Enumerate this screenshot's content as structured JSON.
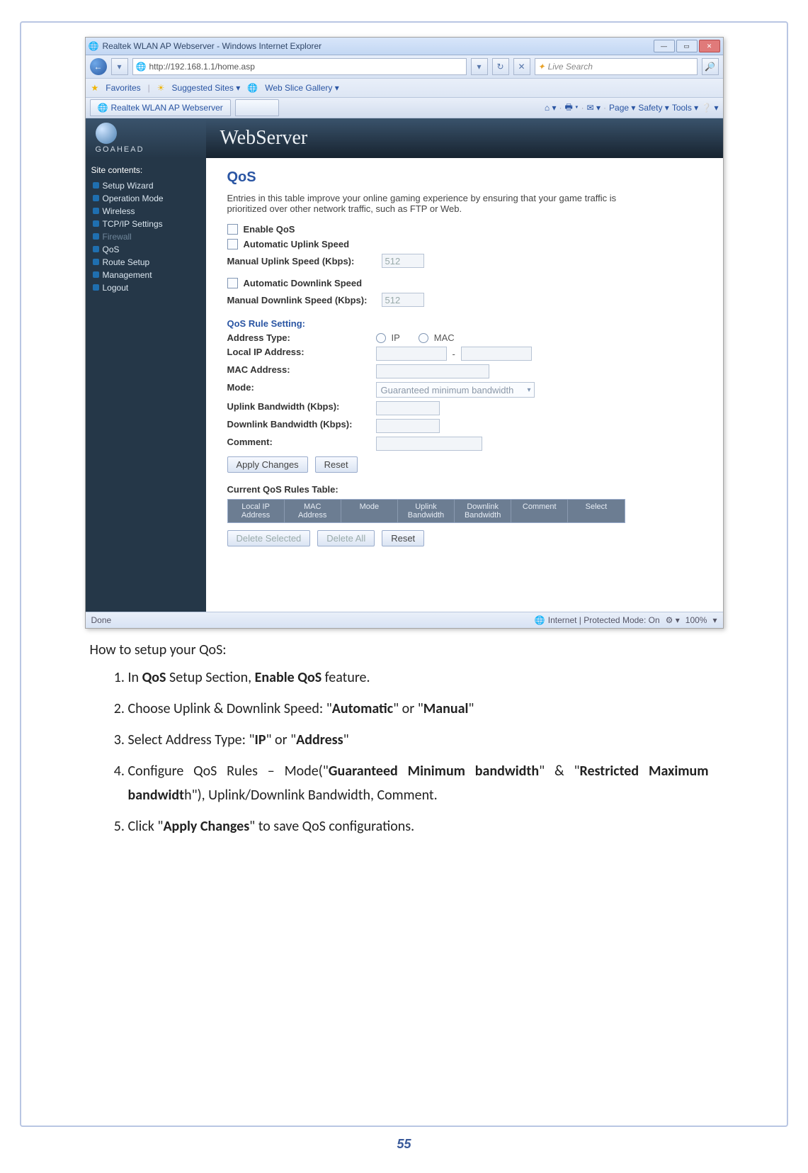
{
  "window": {
    "title": "Realtek WLAN AP Webserver - Windows Internet Explorer",
    "back_icon": "←",
    "fwd_icon": "▾",
    "url": "http://192.168.1.1/home.asp",
    "url_dropdown": "▾",
    "refresh": "↻",
    "stop": "✕",
    "search_icon": "🔍",
    "search_provider": "Live Search",
    "search_go": "🔎"
  },
  "favbar": {
    "label": "Favorites",
    "item1": "Suggested Sites ▾",
    "item2": "Web Slice Gallery ▾"
  },
  "tabbar": {
    "tab1": "Realtek WLAN AP Webserver",
    "tools": {
      "home": "⌂ ▾",
      "feed": "🖶 ▾",
      "mail": "✉ ▾",
      "page": "Page ▾",
      "safety": "Safety ▾",
      "toolsm": "Tools ▾",
      "help": "❔ ▾"
    }
  },
  "brand": {
    "goahead": "GOAHEAD",
    "product": "WebServer"
  },
  "sidebar": {
    "title": "Site contents:",
    "items": [
      {
        "label": "Setup Wizard"
      },
      {
        "label": "Operation Mode"
      },
      {
        "label": "Wireless"
      },
      {
        "label": "TCP/IP Settings"
      },
      {
        "label": "Firewall",
        "dim": true
      },
      {
        "label": "QoS"
      },
      {
        "label": "Route Setup"
      },
      {
        "label": "Management"
      },
      {
        "label": "Logout"
      }
    ]
  },
  "qos": {
    "heading": "QoS",
    "desc": "Entries in this table improve your online gaming experience by ensuring that your game traffic is prioritized over other network traffic, such as FTP or Web.",
    "enable": "Enable QoS",
    "auto_up": "Automatic Uplink Speed",
    "manual_up": "Manual Uplink Speed (Kbps):",
    "manual_up_val": "512",
    "auto_down": "Automatic Downlink Speed",
    "manual_down": "Manual Downlink Speed (Kbps):",
    "manual_down_val": "512",
    "rule_title": "QoS Rule Setting:",
    "addr_type": "Address Type:",
    "ip": "IP",
    "mac": "MAC",
    "local_ip": "Local IP Address:",
    "dash": "-",
    "mac_addr": "MAC Address:",
    "mode": "Mode:",
    "mode_val": "Guaranteed minimum bandwidth",
    "up_bw": "Uplink Bandwidth (Kbps):",
    "down_bw": "Downlink Bandwidth (Kbps):",
    "comment": "Comment:",
    "apply": "Apply Changes",
    "reset": "Reset",
    "curr_title": "Current QoS Rules Table:",
    "th": {
      "c1": "Local IP Address",
      "c2": "MAC Address",
      "c3": "Mode",
      "c4": "Uplink Bandwidth",
      "c5": "Downlink Bandwidth",
      "c6": "Comment",
      "c7": "Select"
    },
    "del_sel": "Delete Selected",
    "del_all": "Delete All",
    "reset2": "Reset"
  },
  "statusbar": {
    "done": "Done",
    "zone": "Internet | Protected Mode: On",
    "zone_icon": "🌐",
    "zoom_sel": "⚙ ▾",
    "zoom": "100%",
    "zoom_arrow": "▾"
  },
  "doc": {
    "lead": "How to setup your QoS:",
    "steps": {
      "s1a": "In ",
      "s1b": "QoS",
      "s1c": " Setup Section, ",
      "s1d": "Enable QoS",
      "s1e": " feature.",
      "s2a": "Choose Uplink & Downlink Speed: \"",
      "s2b": "Automatic",
      "s2c": "\" or \"",
      "s2d": "Manual",
      "s2e": "\"",
      "s3a": "Select Address Type: \"",
      "s3b": "IP",
      "s3c": "\" or \"",
      "s3d": "Address",
      "s3e": "\"",
      "s4a": "Configure QoS Rules – Mode(\"",
      "s4b": "Guaranteed Minimum bandwidth",
      "s4c": "\" & \"",
      "s4d": "Restricted Maximum bandwidt",
      "s4e": "h\"), Uplink/Downlink Bandwidth, Comment.",
      "s5a": "Click \"",
      "s5b": "Apply Changes",
      "s5c": "\" to save QoS configurations."
    },
    "pagenum": "55"
  }
}
